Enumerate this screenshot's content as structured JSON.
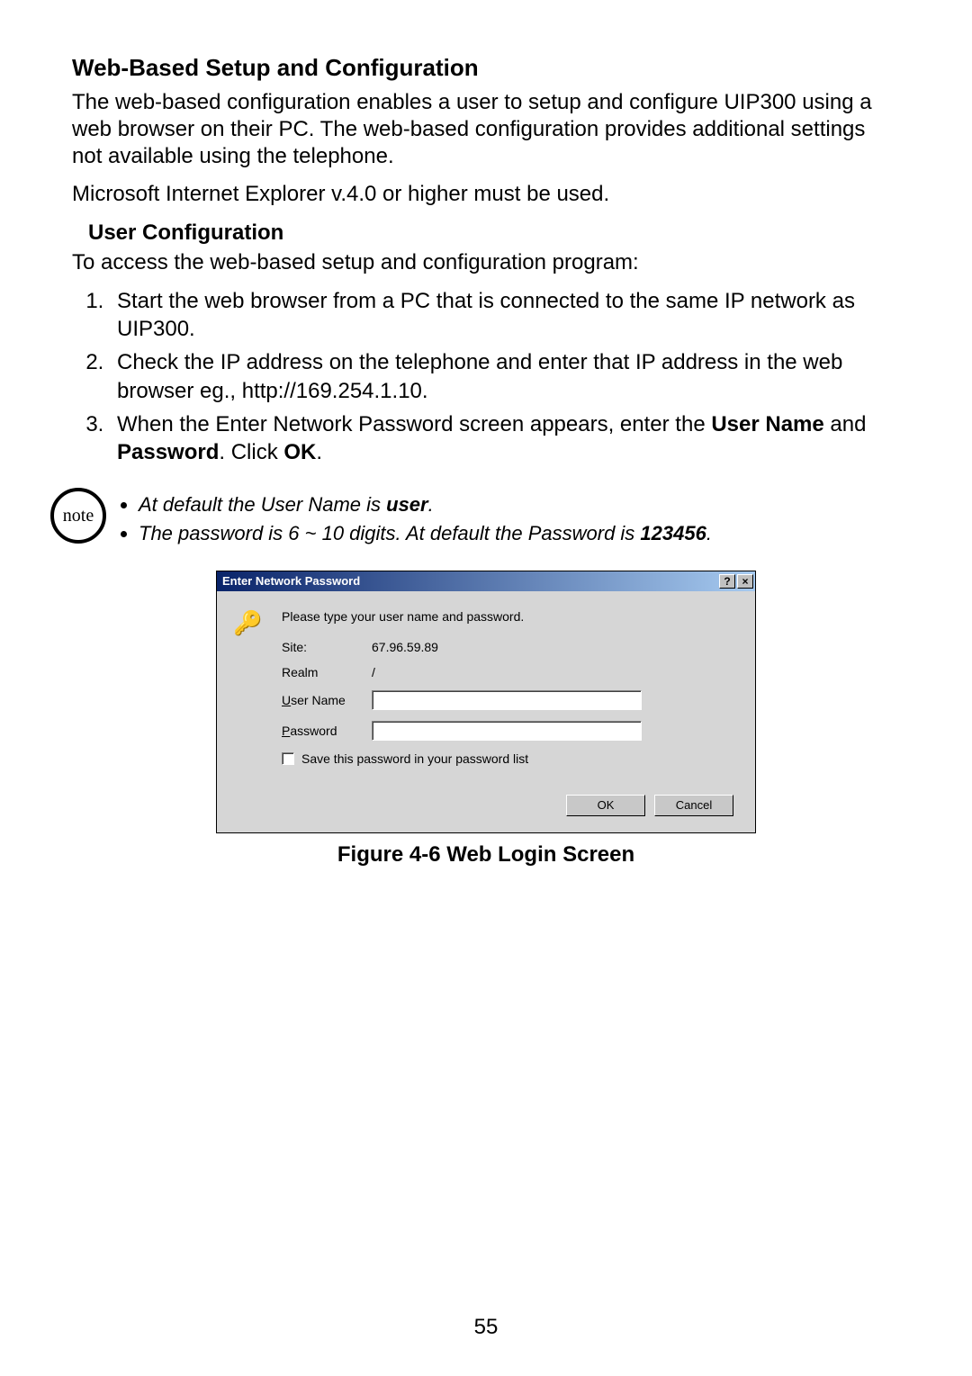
{
  "heading1": "Web-Based Setup and Configuration",
  "para1": "The web-based configuration enables a user to setup and configure UIP300 using a web browser on their PC. The web-based configuration provides additional settings not available using the telephone.",
  "para2": "Microsoft Internet Explorer v.4.0 or higher must be used.",
  "heading2": "User Configuration",
  "para3": "To access the web-based setup and configuration program:",
  "steps": {
    "s1": "Start the web browser from a PC that is connected to the same IP network as UIP300.",
    "s2": "Check the IP address on the telephone and enter that IP address in the web browser eg., http://169.254.1.10.",
    "s3a": "When the Enter Network Password screen appears, enter the ",
    "s3b_bold": "User Name",
    "s3c": " and ",
    "s3d_bold": "Password",
    "s3e": ". Click ",
    "s3f_bold": "OK",
    "s3g": "."
  },
  "note": {
    "badge": "note",
    "line1a": "At default the User Name is ",
    "line1b_bold": "user",
    "line1c": ".",
    "line2a": "The password is 6 ~ 10 digits. At default the Password is ",
    "line2b_bold": "123456",
    "line2c": "."
  },
  "dialog": {
    "title": "Enter Network Password",
    "help_glyph": "?",
    "close_glyph": "×",
    "icon_glyph": "🔑",
    "instruction": "Please type your user name and password.",
    "site_label": "Site:",
    "site_value": "67.96.59.89",
    "realm_label": "Realm",
    "realm_value": "/",
    "user_label_pre": "U",
    "user_label_post": "ser Name",
    "pass_label_pre": "P",
    "pass_label_post": "assword",
    "save_pre": "S",
    "save_post": "ave this password in your password list",
    "ok": "OK",
    "cancel": "Cancel"
  },
  "figure_caption": "Figure 4-6 Web Login Screen",
  "page_number": "55"
}
